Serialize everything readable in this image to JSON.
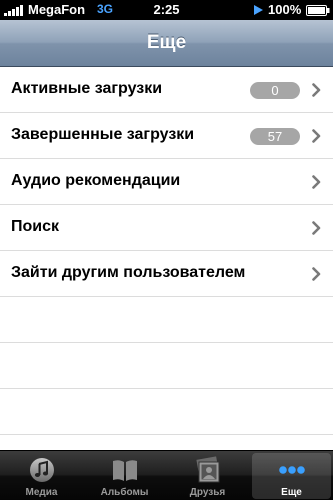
{
  "status_bar": {
    "carrier": "MegaFon",
    "network": "3G",
    "time": "2:25",
    "battery": "100%"
  },
  "nav": {
    "title": "Еще"
  },
  "menu": {
    "items": [
      {
        "label": "Активные загрузки",
        "badge": "0"
      },
      {
        "label": "Завершенные загрузки",
        "badge": "57"
      },
      {
        "label": "Аудио рекомендации"
      },
      {
        "label": "Поиск"
      },
      {
        "label": "Зайти другим пользователем"
      }
    ]
  },
  "tab_bar": {
    "tabs": [
      {
        "label": "Медиа",
        "icon": "music-note-icon"
      },
      {
        "label": "Альбомы",
        "icon": "book-icon"
      },
      {
        "label": "Друзья",
        "icon": "photos-icon"
      },
      {
        "label": "Еще",
        "icon": "more-dots-icon",
        "active": true
      }
    ]
  },
  "colors": {
    "nav_accent": "#8fa2b8",
    "badge": "#a6a6a6",
    "network": "#4aa3ff"
  }
}
